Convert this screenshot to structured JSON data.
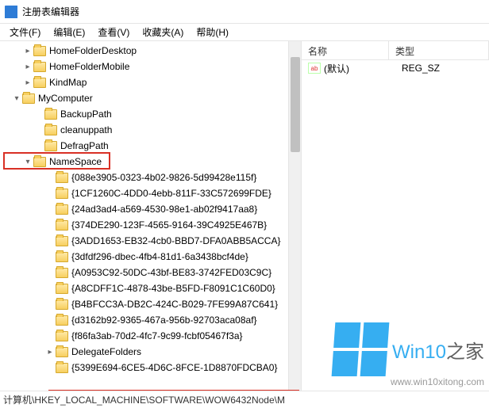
{
  "window": {
    "title": "注册表编辑器"
  },
  "menu": {
    "file": "文件(F)",
    "edit": "编辑(E)",
    "view": "查看(V)",
    "favorites": "收藏夹(A)",
    "help": "帮助(H)"
  },
  "tree": {
    "top_nodes": [
      {
        "label": "HomeFolderDesktop",
        "indent": 28
      },
      {
        "label": "HomeFolderMobile",
        "indent": 28
      },
      {
        "label": "KindMap",
        "indent": 28
      }
    ],
    "mycomputer": {
      "label": "MyComputer",
      "indent": 14,
      "chev": "▾"
    },
    "mc_children": [
      {
        "label": "BackupPath",
        "indent": 42
      },
      {
        "label": "cleanuppath",
        "indent": 42
      },
      {
        "label": "DefragPath",
        "indent": 42
      }
    ],
    "namespace": {
      "label": "NameSpace",
      "indent": 28,
      "chev": "▾"
    },
    "ns_children": [
      {
        "label": "{088e3905-0323-4b02-9826-5d99428e115f}"
      },
      {
        "label": "{1CF1260C-4DD0-4ebb-811F-33C572699FDE}"
      },
      {
        "label": "{24ad3ad4-a569-4530-98e1-ab02f9417aa8}"
      },
      {
        "label": "{374DE290-123F-4565-9164-39C4925E467B}"
      },
      {
        "label": "{3ADD1653-EB32-4cb0-BBD7-DFA0ABB5ACCA}"
      },
      {
        "label": "{3dfdf296-dbec-4fb4-81d1-6a3438bcf4de}"
      },
      {
        "label": "{A0953C92-50DC-43bf-BE83-3742FED03C9C}"
      },
      {
        "label": "{A8CDFF1C-4878-43be-B5FD-F8091C1C60D0}"
      },
      {
        "label": "{B4BFCC3A-DB2C-424C-B029-7FE99A87C641}"
      },
      {
        "label": "{d3162b92-9365-467a-956b-92703aca08af}"
      },
      {
        "label": "{f86fa3ab-70d2-4fc7-9c99-fcbf05467f3a}"
      },
      {
        "label": "DelegateFolders",
        "chev": "▸"
      },
      {
        "label": "{5399E694-6CE5-4D6C-8FCE-1D8870FDCBA0}"
      }
    ]
  },
  "list": {
    "col_name": "名称",
    "col_type": "类型",
    "rows": [
      {
        "icon": "ab",
        "name": "(默认)",
        "type": "REG_SZ"
      }
    ]
  },
  "status": {
    "path": "计算机\\HKEY_LOCAL_MACHINE\\SOFTWARE\\WOW6432Node\\M"
  },
  "watermark": {
    "big": "Win10",
    "suffix": "之家",
    "url": "www.win10xitong.com"
  }
}
